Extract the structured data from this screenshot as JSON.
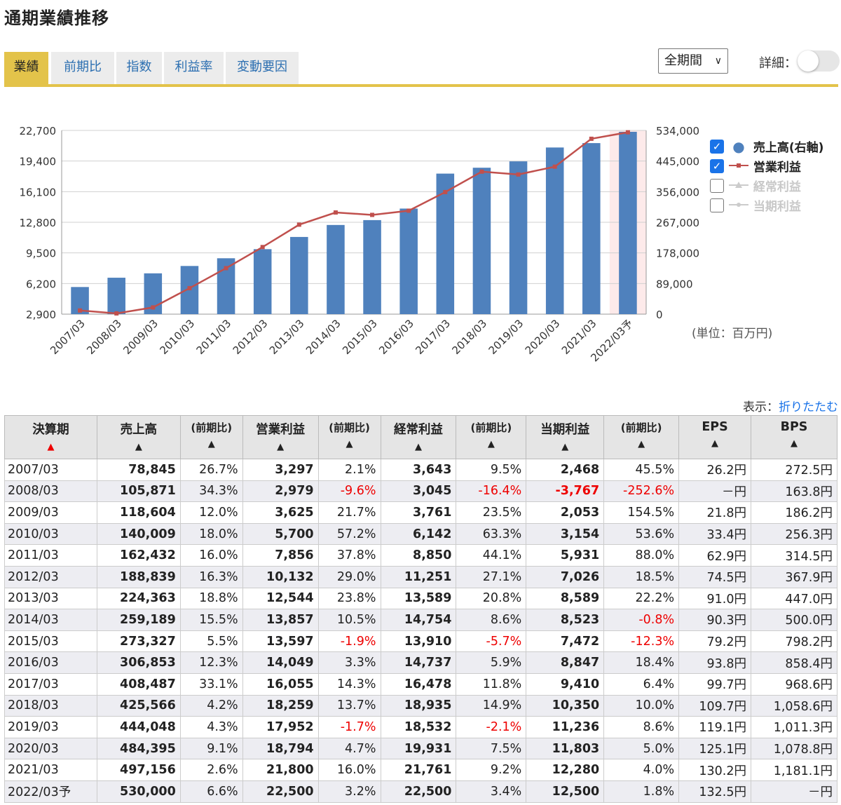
{
  "title": "通期業績推移",
  "tabs": [
    "業績",
    "前期比",
    "指数",
    "利益率",
    "変動要因"
  ],
  "period_select": "全期間",
  "detail_label": "詳細：",
  "colors": {
    "bar": "#4f81bd",
    "op_line": "#c0504d",
    "tab_active": "#e3c34a",
    "negative": "#e00000"
  },
  "chart_data": {
    "type": "bar+line",
    "categories": [
      "2007/03",
      "2008/03",
      "2009/03",
      "2010/03",
      "2011/03",
      "2012/03",
      "2013/03",
      "2014/03",
      "2015/03",
      "2016/03",
      "2017/03",
      "2018/03",
      "2019/03",
      "2020/03",
      "2021/03",
      "2022/03予"
    ],
    "series": [
      {
        "name": "売上高(右軸)",
        "type": "bar",
        "axis": "right",
        "values": [
          78845,
          105871,
          118604,
          140009,
          162432,
          188839,
          224363,
          259189,
          273327,
          306853,
          408487,
          425566,
          444048,
          484395,
          497156,
          530000
        ]
      },
      {
        "name": "営業利益",
        "type": "line",
        "axis": "left",
        "values": [
          3297,
          2979,
          3625,
          5700,
          7856,
          10132,
          12544,
          13857,
          13597,
          14049,
          16055,
          18259,
          17952,
          18794,
          21800,
          22500
        ]
      }
    ],
    "left_axis": {
      "ticks": [
        "22,700",
        "19,400",
        "16,100",
        "12,800",
        "9,500",
        "6,200",
        "2,900"
      ],
      "range": [
        2900,
        22700
      ]
    },
    "right_axis": {
      "ticks": [
        "534,000",
        "445,000",
        "356,000",
        "267,000",
        "178,000",
        "89,000",
        "0"
      ],
      "range": [
        0,
        534000
      ]
    },
    "forecast_highlight": "2022/03予",
    "grid": true
  },
  "legend": [
    {
      "label": "売上高(右軸)",
      "checked": true,
      "symbol": "●"
    },
    {
      "label": "営業利益",
      "checked": true,
      "symbol": "—■—"
    },
    {
      "label": "経常利益",
      "checked": false,
      "symbol": "—▲—"
    },
    {
      "label": "当期利益",
      "checked": false,
      "symbol": "—●—"
    }
  ],
  "unit_note": "(単位：百万円)",
  "display": {
    "label": "表示：",
    "link": "折りたたむ"
  },
  "table": {
    "headers": [
      "決算期",
      "売上高",
      "(前期比)",
      "営業利益",
      "(前期比)",
      "経常利益",
      "(前期比)",
      "当期利益",
      "(前期比)",
      "EPS",
      "BPS"
    ],
    "rows": [
      [
        "2007/03",
        "78,845",
        "26.7%",
        "3,297",
        "2.1%",
        "3,643",
        "9.5%",
        "2,468",
        "45.5%",
        "26.2円",
        "272.5円"
      ],
      [
        "2008/03",
        "105,871",
        "34.3%",
        "2,979",
        "-9.6%",
        "3,045",
        "-16.4%",
        "-3,767",
        "-252.6%",
        "－円",
        "163.8円"
      ],
      [
        "2009/03",
        "118,604",
        "12.0%",
        "3,625",
        "21.7%",
        "3,761",
        "23.5%",
        "2,053",
        "154.5%",
        "21.8円",
        "186.2円"
      ],
      [
        "2010/03",
        "140,009",
        "18.0%",
        "5,700",
        "57.2%",
        "6,142",
        "63.3%",
        "3,154",
        "53.6%",
        "33.4円",
        "256.3円"
      ],
      [
        "2011/03",
        "162,432",
        "16.0%",
        "7,856",
        "37.8%",
        "8,850",
        "44.1%",
        "5,931",
        "88.0%",
        "62.9円",
        "314.5円"
      ],
      [
        "2012/03",
        "188,839",
        "16.3%",
        "10,132",
        "29.0%",
        "11,251",
        "27.1%",
        "7,026",
        "18.5%",
        "74.5円",
        "367.9円"
      ],
      [
        "2013/03",
        "224,363",
        "18.8%",
        "12,544",
        "23.8%",
        "13,589",
        "20.8%",
        "8,589",
        "22.2%",
        "91.0円",
        "447.0円"
      ],
      [
        "2014/03",
        "259,189",
        "15.5%",
        "13,857",
        "10.5%",
        "14,754",
        "8.6%",
        "8,523",
        "-0.8%",
        "90.3円",
        "500.0円"
      ],
      [
        "2015/03",
        "273,327",
        "5.5%",
        "13,597",
        "-1.9%",
        "13,910",
        "-5.7%",
        "7,472",
        "-12.3%",
        "79.2円",
        "798.2円"
      ],
      [
        "2016/03",
        "306,853",
        "12.3%",
        "14,049",
        "3.3%",
        "14,737",
        "5.9%",
        "8,847",
        "18.4%",
        "93.8円",
        "858.4円"
      ],
      [
        "2017/03",
        "408,487",
        "33.1%",
        "16,055",
        "14.3%",
        "16,478",
        "11.8%",
        "9,410",
        "6.4%",
        "99.7円",
        "968.6円"
      ],
      [
        "2018/03",
        "425,566",
        "4.2%",
        "18,259",
        "13.7%",
        "18,935",
        "14.9%",
        "10,350",
        "10.0%",
        "109.7円",
        "1,058.6円"
      ],
      [
        "2019/03",
        "444,048",
        "4.3%",
        "17,952",
        "-1.7%",
        "18,532",
        "-2.1%",
        "11,236",
        "8.6%",
        "119.1円",
        "1,011.3円"
      ],
      [
        "2020/03",
        "484,395",
        "9.1%",
        "18,794",
        "4.7%",
        "19,931",
        "7.5%",
        "11,803",
        "5.0%",
        "125.1円",
        "1,078.8円"
      ],
      [
        "2021/03",
        "497,156",
        "2.6%",
        "21,800",
        "16.0%",
        "21,761",
        "9.2%",
        "12,280",
        "4.0%",
        "130.2円",
        "1,181.1円"
      ],
      [
        "2022/03予",
        "530,000",
        "6.6%",
        "22,500",
        "3.2%",
        "22,500",
        "3.4%",
        "12,500",
        "1.8%",
        "132.5円",
        "－円"
      ]
    ]
  }
}
